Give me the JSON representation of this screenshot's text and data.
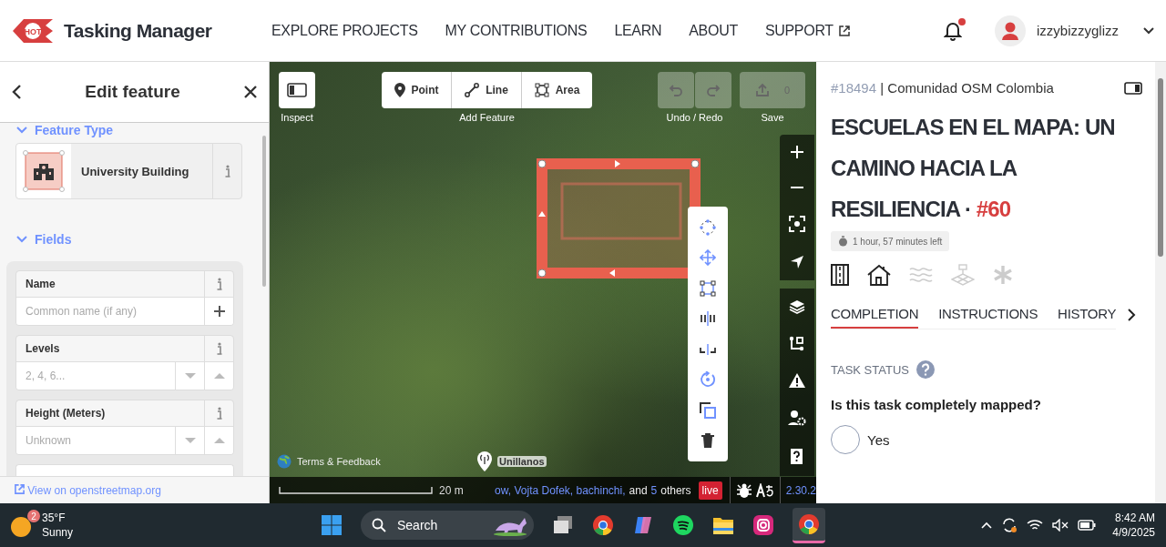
{
  "header": {
    "logo_badge": "HOT",
    "app_name": "Tasking Manager",
    "nav": [
      {
        "label": "EXPLORE PROJECTS",
        "external": false
      },
      {
        "label": "MY CONTRIBUTIONS",
        "external": false
      },
      {
        "label": "LEARN",
        "external": false
      },
      {
        "label": "ABOUT",
        "external": false
      },
      {
        "label": "SUPPORT",
        "external": true
      }
    ],
    "notifications": {
      "unread": true
    },
    "user": {
      "name": "izzybizzyglizz"
    }
  },
  "editor_panel": {
    "title": "Edit feature",
    "feature_type": {
      "heading": "Feature Type",
      "expanded": true,
      "name": "University Building"
    },
    "fields_section": {
      "heading": "Fields",
      "expanded": true
    },
    "fields": [
      {
        "label": "Name",
        "placeholder": "Common name (if any)",
        "kind": "text"
      },
      {
        "label": "Levels",
        "placeholder": "2, 4, 6...",
        "kind": "number"
      },
      {
        "label": "Height (Meters)",
        "placeholder": "Unknown",
        "kind": "number"
      }
    ],
    "footer_link": "View on openstreetmap.org"
  },
  "map": {
    "toolbar": {
      "inspect_label": "Inspect",
      "add_modes": [
        {
          "label": "Point",
          "kind": "point"
        },
        {
          "label": "Line",
          "kind": "line"
        },
        {
          "label": "Area",
          "kind": "area"
        }
      ],
      "add_label": "Add Feature",
      "undo_redo_label": "Undo / Redo",
      "save_count": "0",
      "save_label": "Save"
    },
    "terms": "Terms & Feedback",
    "place_label": "Unillanos",
    "scale": "20 m",
    "attribution": [
      {
        "text": "ow, Vojta Dofek, bachinchi,",
        "kind": "link"
      },
      {
        "text": "and",
        "kind": "text"
      },
      {
        "text": "5",
        "kind": "link"
      },
      {
        "text": "others",
        "kind": "text"
      }
    ],
    "live": "live",
    "version": "2.30.2"
  },
  "task_panel": {
    "project_id": "#18494",
    "id_separator": "|",
    "organisation": "Comunidad OSM Colombia",
    "title": "ESCUELAS EN EL MAPA: UN CAMINO HACIA LA RESILIENCIA",
    "title_separator": "·",
    "task_number": "#60",
    "time_left": "1 hour, 57 minutes left",
    "feature_types": [
      {
        "kind": "roads",
        "active": true
      },
      {
        "kind": "buildings",
        "active": true
      },
      {
        "kind": "waterways",
        "active": false
      },
      {
        "kind": "landuse",
        "active": false
      },
      {
        "kind": "other",
        "active": false
      }
    ],
    "tabs": [
      {
        "label": "COMPLETION",
        "selected": true
      },
      {
        "label": "INSTRUCTIONS",
        "selected": false
      },
      {
        "label": "HISTORY",
        "selected": false
      }
    ],
    "status_heading": "TASK STATUS",
    "question": "Is this task completely mapped?",
    "options": [
      {
        "label": "Yes",
        "selected": false
      }
    ]
  },
  "taskbar": {
    "weather_badge": "2",
    "temperature": "35°F",
    "condition": "Sunny",
    "search": "Search",
    "time": "8:42 AM",
    "date": "4/9/2025"
  }
}
